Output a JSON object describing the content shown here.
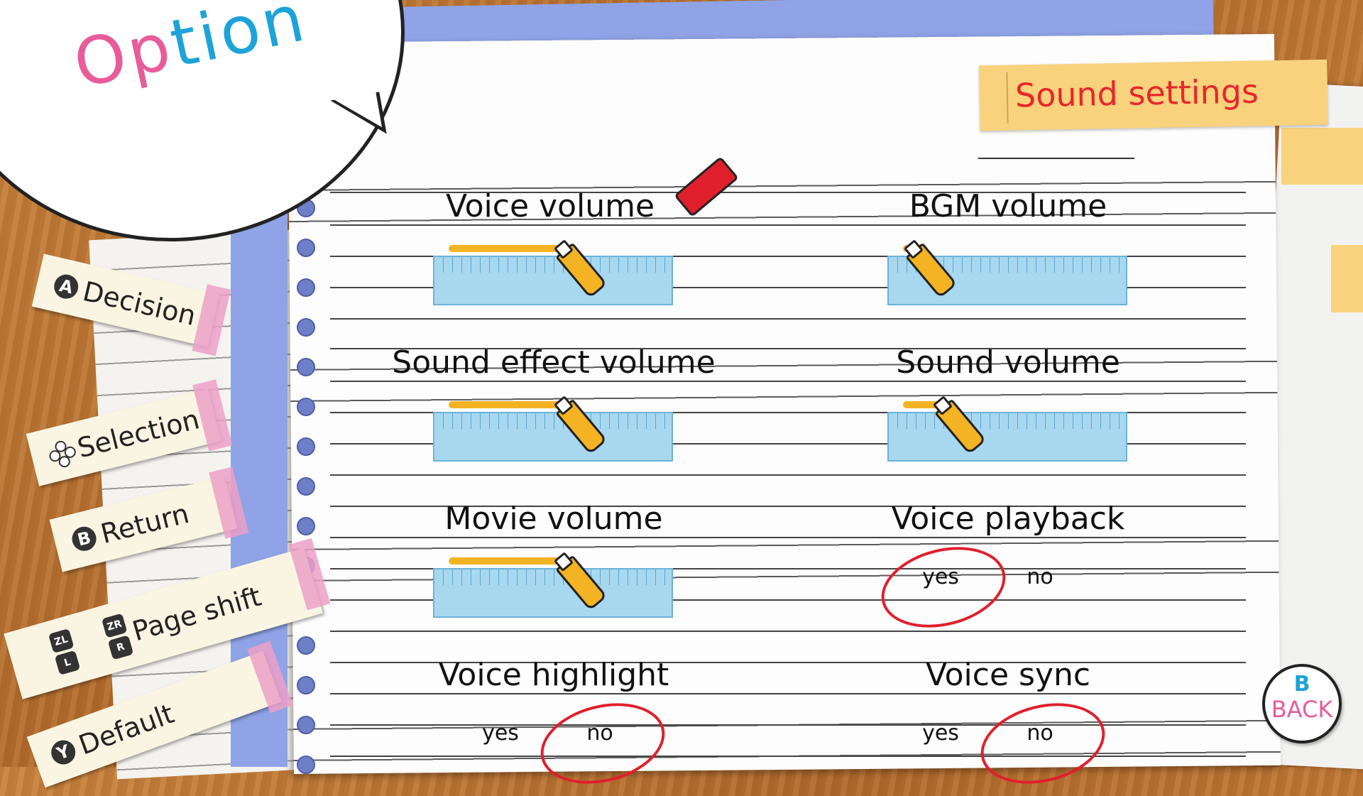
{
  "title": {
    "part1": "Op",
    "part2": "tion"
  },
  "tab": {
    "label": "Sound settings"
  },
  "controls": [
    {
      "button": "A",
      "label": "Decision"
    },
    {
      "button": "dpad",
      "label": "Selection"
    },
    {
      "button": "B",
      "label": "Return"
    },
    {
      "buttons": [
        "ZL",
        "L",
        "ZR",
        "R"
      ],
      "label": "Page shift"
    },
    {
      "button": "Y",
      "label": "Default"
    }
  ],
  "settings": {
    "voice_volume": {
      "label": "Voice volume",
      "level": 0.58
    },
    "bgm_volume": {
      "label": "BGM volume",
      "level": 0.08
    },
    "sound_effect_volume": {
      "label": "Sound effect volume",
      "level": 0.58
    },
    "sound_volume": {
      "label": "Sound volume",
      "level": 0.22
    },
    "movie_volume": {
      "label": "Movie volume",
      "level": 0.58
    },
    "voice_playback": {
      "label": "Voice playback",
      "yes": "yes",
      "no": "no",
      "selected": "yes"
    },
    "voice_highlight": {
      "label": "Voice highlight",
      "yes": "yes",
      "no": "no",
      "selected": "no"
    },
    "voice_sync": {
      "label": "Voice sync",
      "yes": "yes",
      "no": "no",
      "selected": "no"
    }
  },
  "back": {
    "button": "B",
    "label": "BACK"
  },
  "colors": {
    "accent_red": "#e01f2d",
    "marker_yellow": "#f4b323",
    "ruler_blue": "#a8d8f0",
    "title_pink": "#e85c9a",
    "title_blue": "#1ea3d8"
  }
}
